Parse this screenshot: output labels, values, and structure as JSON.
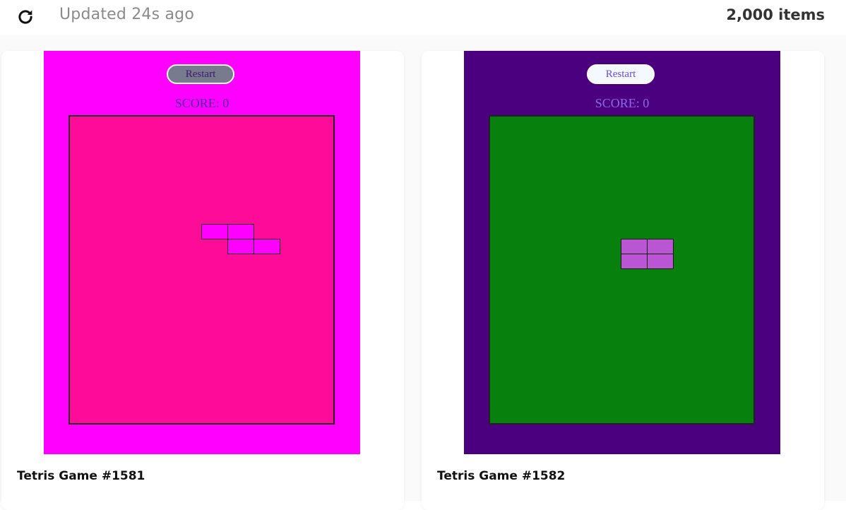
{
  "header": {
    "refresh_icon": "refresh-icon",
    "updated_text": "Updated 24s ago",
    "items_count": "2,000 items"
  },
  "cards": [
    {
      "title": "Tetris Game #1581",
      "restart_label": "Restart",
      "score_text": "SCORE: 0",
      "colors": {
        "background": "#ff00ff",
        "board": "#fe0c99",
        "restart_bg": "#787a8e",
        "restart_text": "#3a1a6e",
        "score_text": "#4d2aa0",
        "piece": "#ff00ff"
      }
    },
    {
      "title": "Tetris Game #1582",
      "restart_label": "Restart",
      "score_text": "SCORE: 0",
      "colors": {
        "background": "#4b0080",
        "board": "#08800e",
        "restart_bg": "#f4f8ff",
        "restart_text": "#6a4ae0",
        "score_text": "#8a6ae8",
        "piece": "#ba55d3"
      }
    }
  ]
}
